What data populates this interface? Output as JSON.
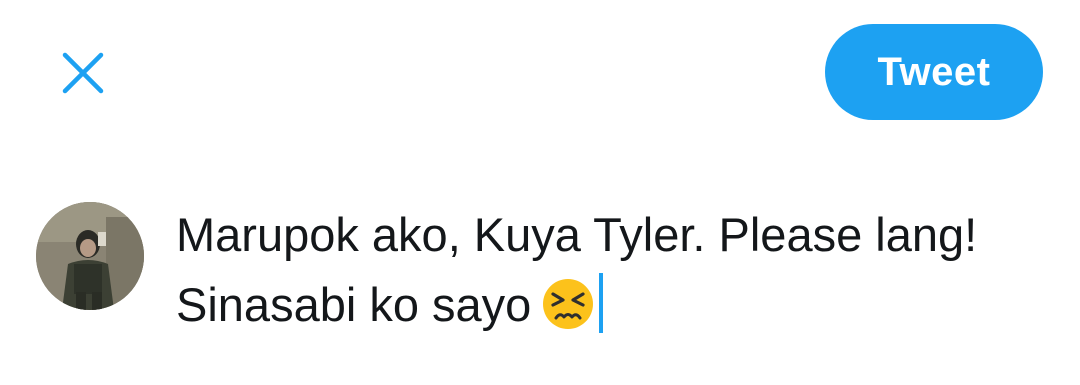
{
  "header": {
    "close_icon": "close-icon",
    "tweet_label": "Tweet",
    "accent_color": "#1da1f2"
  },
  "composer": {
    "avatar_icon": "profile-avatar",
    "text": "Marupok ako, Kuya Tyler. Please lang! Sinasabi ko sayo",
    "emoji": "persevering-face-emoji"
  }
}
